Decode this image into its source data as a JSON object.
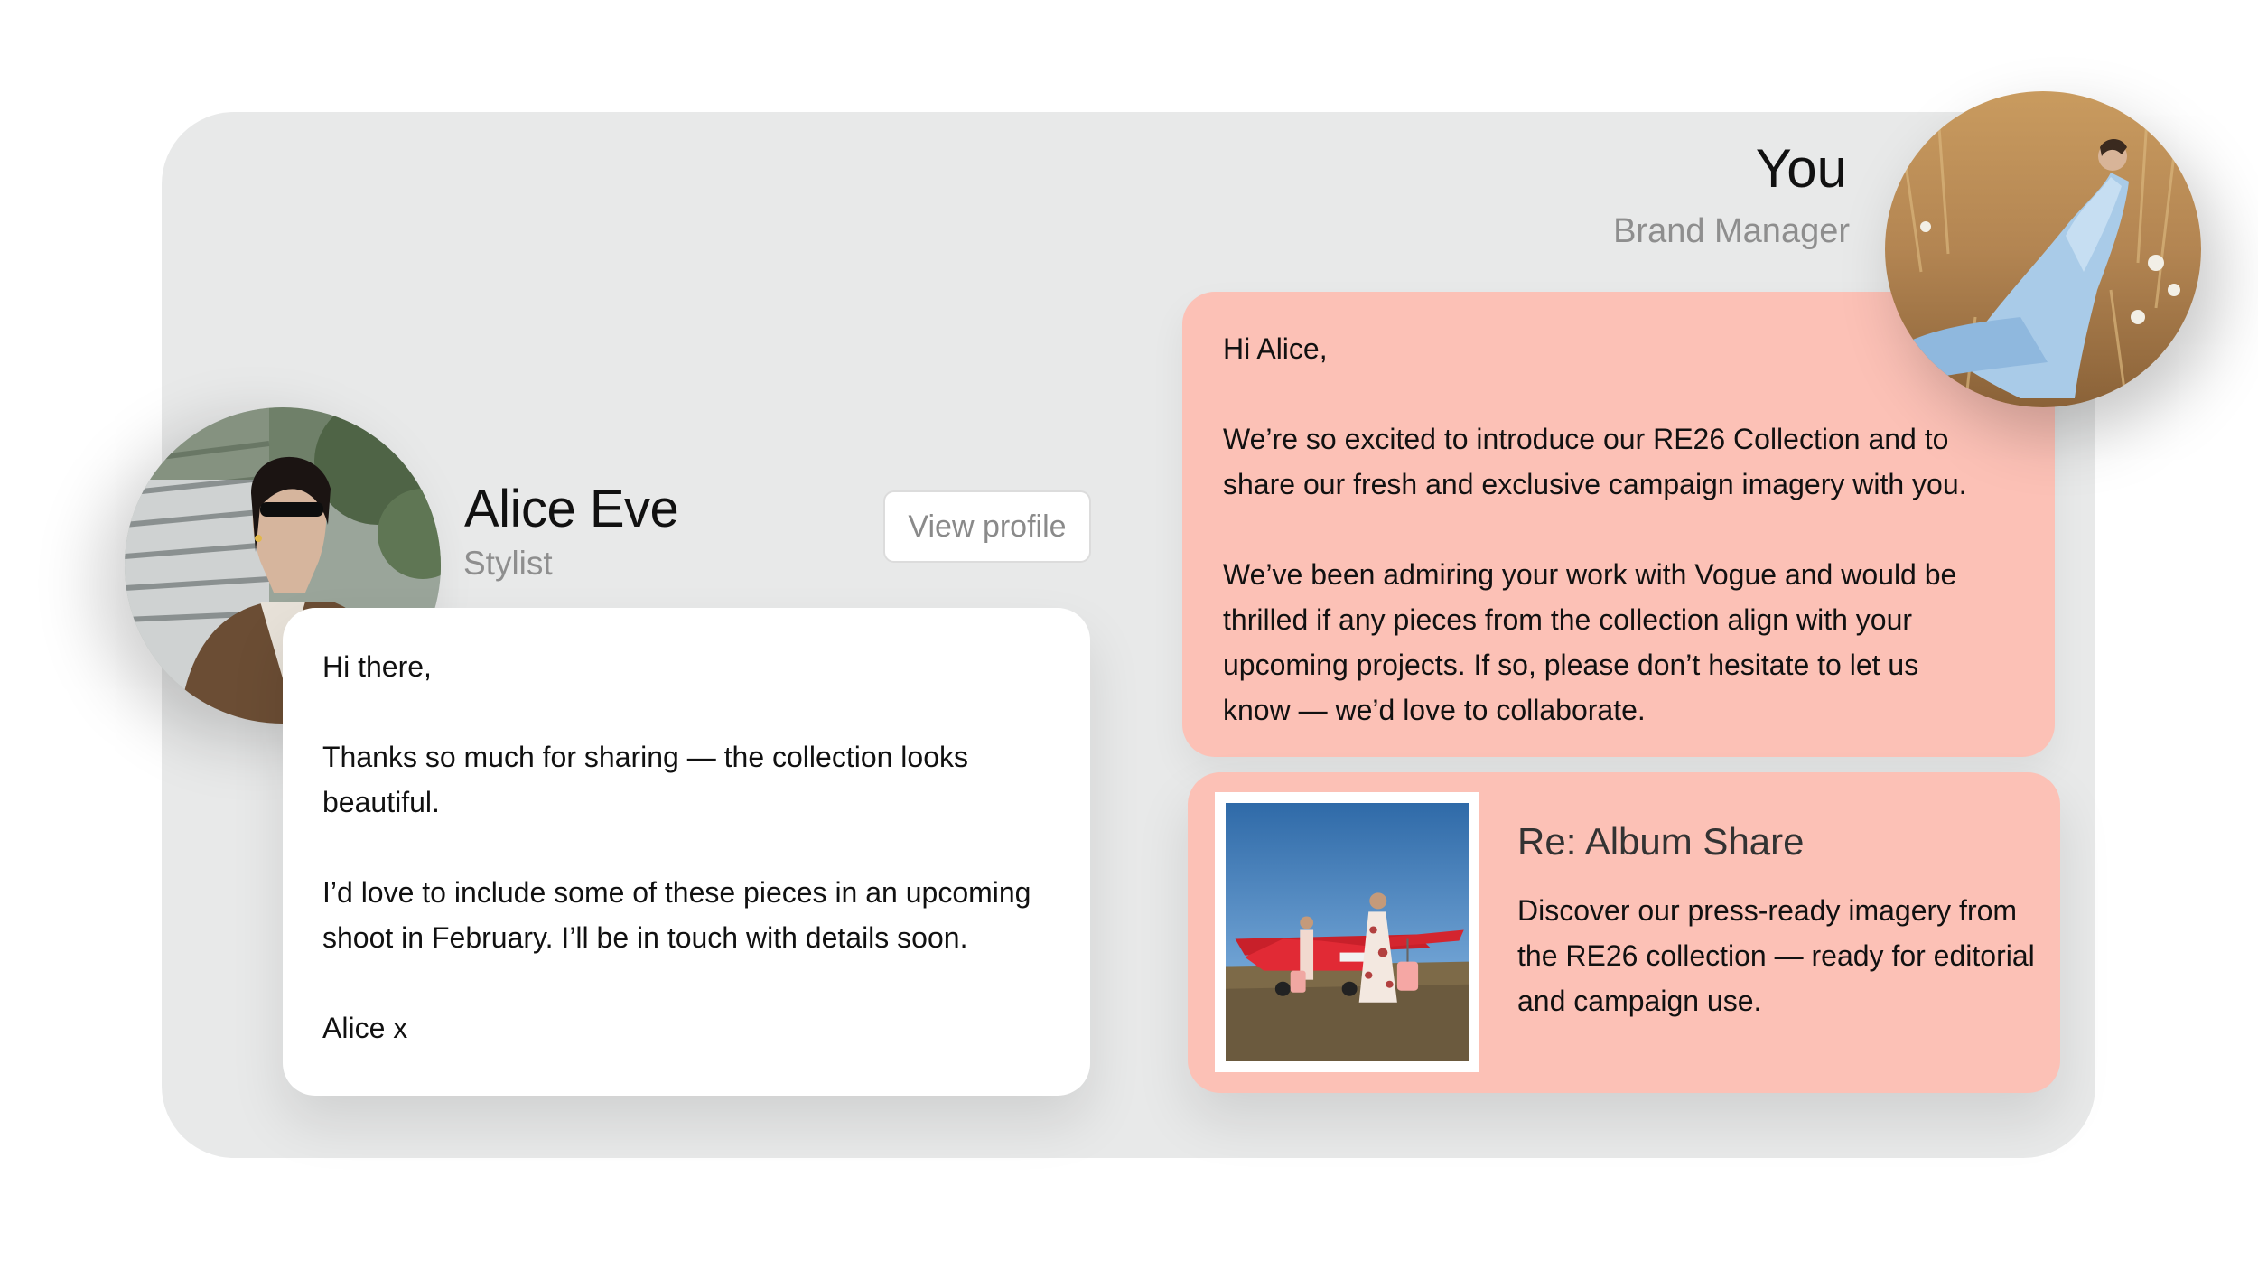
{
  "contact": {
    "name": "Alice Eve",
    "role": "Stylist",
    "view_profile_label": "View profile"
  },
  "self": {
    "name": "You",
    "role": "Brand Manager"
  },
  "messages": {
    "alice": {
      "paragraphs": [
        "Hi there,",
        "Thanks so much for sharing — the collection looks beautiful.",
        "I’d love to include some of these pieces in an upcoming shoot in February. I’ll be in touch with details soon.",
        "Alice x"
      ]
    },
    "you": {
      "paragraphs": [
        "Hi Alice,",
        "We’re so excited to introduce our RE26 Collection and to share our fresh and exclusive campaign imagery with you.",
        "We’ve been admiring your work with Vogue and would be thrilled if any pieces from the collection align with your upcoming projects. If so, please don’t hesitate to let us know — we’d love to collaborate."
      ]
    }
  },
  "album_share": {
    "title": "Re: Album Share",
    "description": "Discover our press-ready imagery from the RE26 collection — ready for editorial and campaign use."
  },
  "colors": {
    "panel": "#e8e9e9",
    "outgoing_bubble": "#fcc1b6",
    "incoming_bubble": "#ffffff",
    "muted_text": "#8e8e8e"
  }
}
